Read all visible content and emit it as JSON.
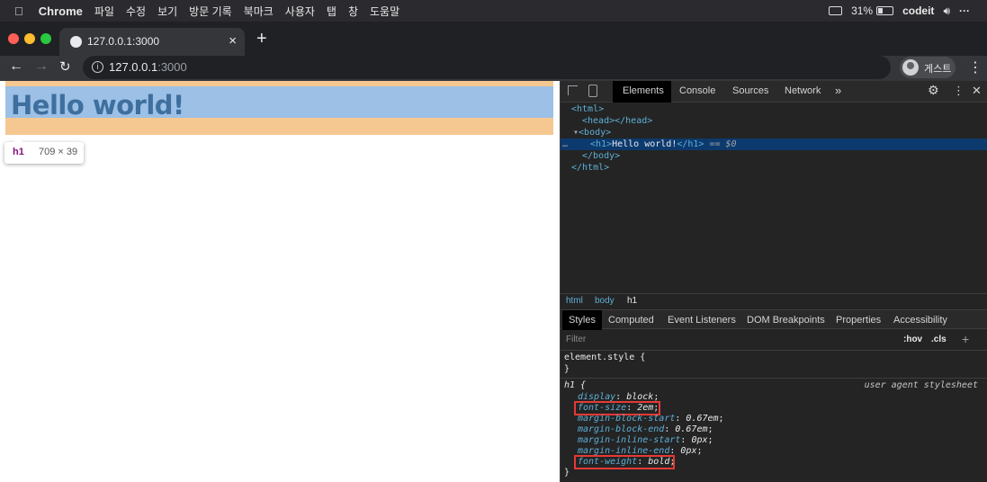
{
  "menubar": {
    "apple": "",
    "app": "Chrome",
    "items": [
      "파일",
      "수정",
      "보기",
      "방문 기록",
      "북마크",
      "사용자",
      "탭",
      "창",
      "도움말"
    ],
    "battery": "31%",
    "user": "codeit",
    "volume_icon": "speaker-icon"
  },
  "browser": {
    "tab_title": "127.0.0.1:3000",
    "tab_close": "×",
    "new_tab": "+",
    "url_host": "127.0.0.1",
    "url_port": ":3000",
    "profile_label": "게스트"
  },
  "page": {
    "h1": "Hello world!",
    "tooltip_tag": "h1",
    "tooltip_size": "709 × 39"
  },
  "devtools": {
    "tabs": [
      "Elements",
      "Console",
      "Sources",
      "Network"
    ],
    "more": "»",
    "dom": {
      "html_open": "<html>",
      "head": "<head></head>",
      "body_open": "<body>",
      "h1_open": "<h1>",
      "h1_text": "Hello world!",
      "h1_close": "</h1>",
      "h1_suffix": " == $0",
      "body_close": "</body>",
      "html_close": "</html>",
      "ellipsis": "…"
    },
    "breadcrumbs": [
      "html",
      "body",
      "h1"
    ],
    "style_tabs": [
      "Styles",
      "Computed",
      "Event Listeners",
      "DOM Breakpoints",
      "Properties",
      "Accessibility"
    ],
    "filter_placeholder": "Filter",
    "hov": ":hov",
    "cls": ".cls",
    "element_style": "element.style {",
    "close_brace": "}",
    "rule_selector": "h1 {",
    "rule_source": "user agent stylesheet",
    "declarations": [
      {
        "prop": "display",
        "value": "block"
      },
      {
        "prop": "font-size",
        "value": "2em"
      },
      {
        "prop": "margin-block-start",
        "value": "0.67em"
      },
      {
        "prop": "margin-block-end",
        "value": "0.67em"
      },
      {
        "prop": "margin-inline-start",
        "value": "0px"
      },
      {
        "prop": "margin-inline-end",
        "value": "0px"
      },
      {
        "prop": "font-weight",
        "value": "bold"
      }
    ],
    "highlight_color": "#e53935"
  },
  "colors": {
    "margin_overlay": "#f6c891",
    "content_overlay": "#9cc0e6",
    "selected_row": "#0d3a6e"
  }
}
